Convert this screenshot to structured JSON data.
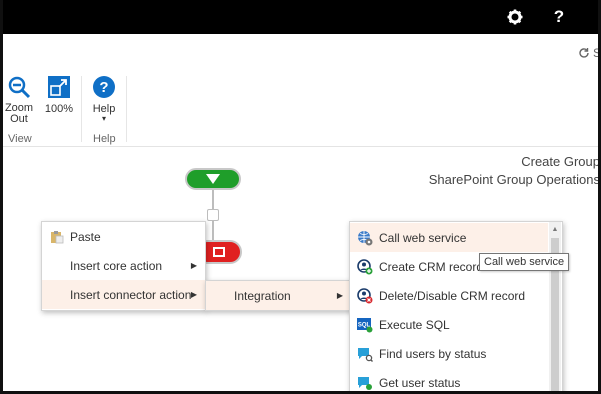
{
  "topbar": {
    "settings_icon": "gear-icon",
    "help_label": "?"
  },
  "subbar": {
    "sync_label": "S"
  },
  "ribbon": {
    "zoom_out_label": "Zoom\nOut",
    "zoom_100_label": "100%",
    "help_label": "Help",
    "help_caret": "▾",
    "group_view": "View",
    "group_help": "Help"
  },
  "canvas": {
    "title_line1": "Create Group",
    "title_line2": "SharePoint Group Operations"
  },
  "context_menu": {
    "paste": "Paste",
    "insert_core_action": "Insert core action",
    "insert_connector_action": "Insert connector action",
    "arrow": "▶"
  },
  "submenu": {
    "integration": "Integration"
  },
  "actions": [
    {
      "label": "Call web service",
      "icon": "globe-icon"
    },
    {
      "label": "Create CRM record",
      "icon": "crm-create-icon"
    },
    {
      "label": "Delete/Disable CRM record",
      "icon": "crm-delete-icon"
    },
    {
      "label": "Execute SQL",
      "icon": "sql-icon"
    },
    {
      "label": "Find users by status",
      "icon": "find-users-icon"
    },
    {
      "label": "Get user status",
      "icon": "user-status-icon"
    }
  ],
  "tooltip": {
    "text": "Call web service"
  },
  "colors": {
    "start": "#1f9e2a",
    "stop": "#e02020",
    "highlight": "#fdf0e8",
    "accent": "#0f6fc6"
  }
}
